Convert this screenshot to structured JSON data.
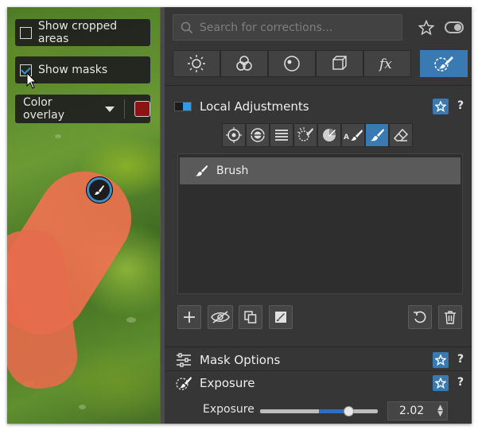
{
  "viewer": {
    "show_cropped_label": "Show cropped areas",
    "show_cropped_checked": false,
    "show_masks_label": "Show masks",
    "show_masks_checked": true,
    "overlay_mode": "Color overlay",
    "overlay_color": "#8b1414"
  },
  "search": {
    "placeholder": "Search for corrections..."
  },
  "palette_tabs": [
    "light-icon",
    "color-icon",
    "detail-icon",
    "geometry-icon",
    "effects-icon",
    "local-adjustments-icon"
  ],
  "palette_active": "local-adjustments-icon",
  "local_adjustments": {
    "title": "Local Adjustments",
    "help": "?",
    "tools": [
      "control-point-icon",
      "radial-filter-icon",
      "graduated-filter-icon",
      "auto-mask-icon",
      "eyedropper-icon",
      "auto-brush-icon",
      "brush-icon",
      "eraser-icon"
    ],
    "active_tool": "brush-icon",
    "mask_items": [
      {
        "label": "Brush"
      }
    ]
  },
  "mask_options": {
    "title": "Mask Options",
    "help": "?"
  },
  "exposure_section": {
    "title": "Exposure",
    "help": "?"
  },
  "exposure_slider": {
    "label": "Exposure",
    "value": "2.02",
    "numeric_value": 2.02,
    "min": -4,
    "max": 4
  },
  "colors": {
    "accent": "#3a7ab2",
    "panel": "#363636",
    "mask": "#e8704c"
  }
}
